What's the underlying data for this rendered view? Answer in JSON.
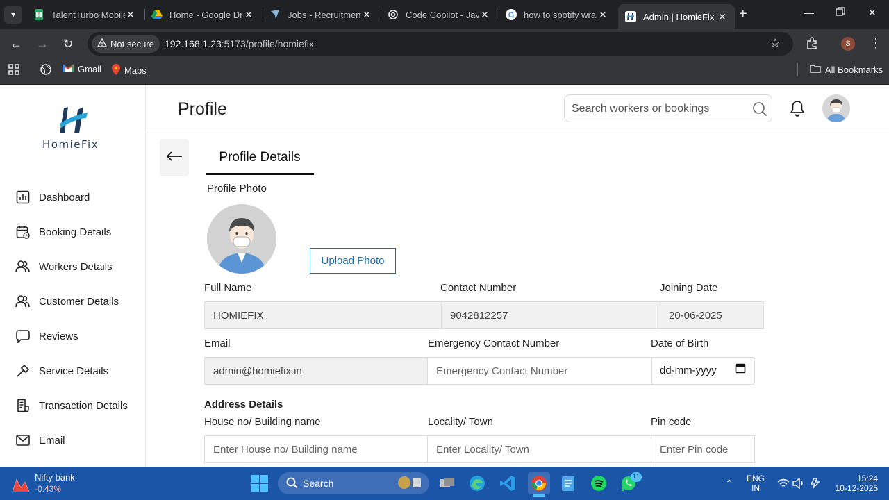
{
  "browser": {
    "tabs": [
      {
        "title": "TalentTurbo Mobile",
        "icon": "sheets-icon"
      },
      {
        "title": "Home - Google Dr",
        "icon": "drive-icon"
      },
      {
        "title": "Jobs - Recruitment",
        "icon": "jobs-icon"
      },
      {
        "title": "Code Copilot - Jav",
        "icon": "openai-icon"
      },
      {
        "title": "how to spotify wra",
        "icon": "google-icon"
      },
      {
        "title": "Admin | HomieFix",
        "icon": "homiefix-icon"
      }
    ],
    "security_label": "Not secure",
    "url_host": "192.168.1.23",
    "url_path": ":5173/profile/homiefix",
    "profile_initial": "S",
    "bookmarks": [
      {
        "label": "Gmail"
      },
      {
        "label": "Maps"
      }
    ],
    "all_bookmarks": "All Bookmarks"
  },
  "app": {
    "logo_text": "HomieFix",
    "page_title": "Profile",
    "search_placeholder": "Search workers or bookings",
    "nav": [
      {
        "label": "Dashboard",
        "icon": "dashboard-icon"
      },
      {
        "label": "Booking Details",
        "icon": "calendar-icon"
      },
      {
        "label": "Workers Details",
        "icon": "workers-icon"
      },
      {
        "label": "Customer Details",
        "icon": "customer-icon"
      },
      {
        "label": "Reviews",
        "icon": "chat-icon"
      },
      {
        "label": "Service Details",
        "icon": "hammer-icon"
      },
      {
        "label": "Transaction Details",
        "icon": "receipt-icon"
      },
      {
        "label": "Email",
        "icon": "mail-icon"
      }
    ],
    "profile": {
      "tab_label": "Profile Details",
      "photo_label": "Profile Photo",
      "upload_label": "Upload Photo",
      "full_name_label": "Full Name",
      "full_name": "HOMIEFIX",
      "contact_label": "Contact Number",
      "contact": "9042812257",
      "joining_label": "Joining Date",
      "joining": "20-06-2025",
      "email_label": "Email",
      "email": "admin@homiefix.in",
      "emergency_label": "Emergency Contact Number",
      "emergency_placeholder": "Emergency Contact Number",
      "dob_label": "Date of Birth",
      "dob_placeholder": "dd-mm-yyyy",
      "address_title": "Address Details",
      "house_label": "House no/ Building name",
      "house_placeholder": "Enter House no/ Building name",
      "locality_label": "Locality/ Town",
      "locality_placeholder": "Enter Locality/ Town",
      "pin_label": "Pin code",
      "pin_placeholder": "Enter Pin code"
    }
  },
  "taskbar": {
    "widget_title": "Nifty bank",
    "widget_value": "-0.43%",
    "search_label": "Search",
    "whatsapp_badge": "11",
    "lang": "ENG",
    "region": "IN",
    "time": "15:24",
    "date": "10-12-2025"
  }
}
